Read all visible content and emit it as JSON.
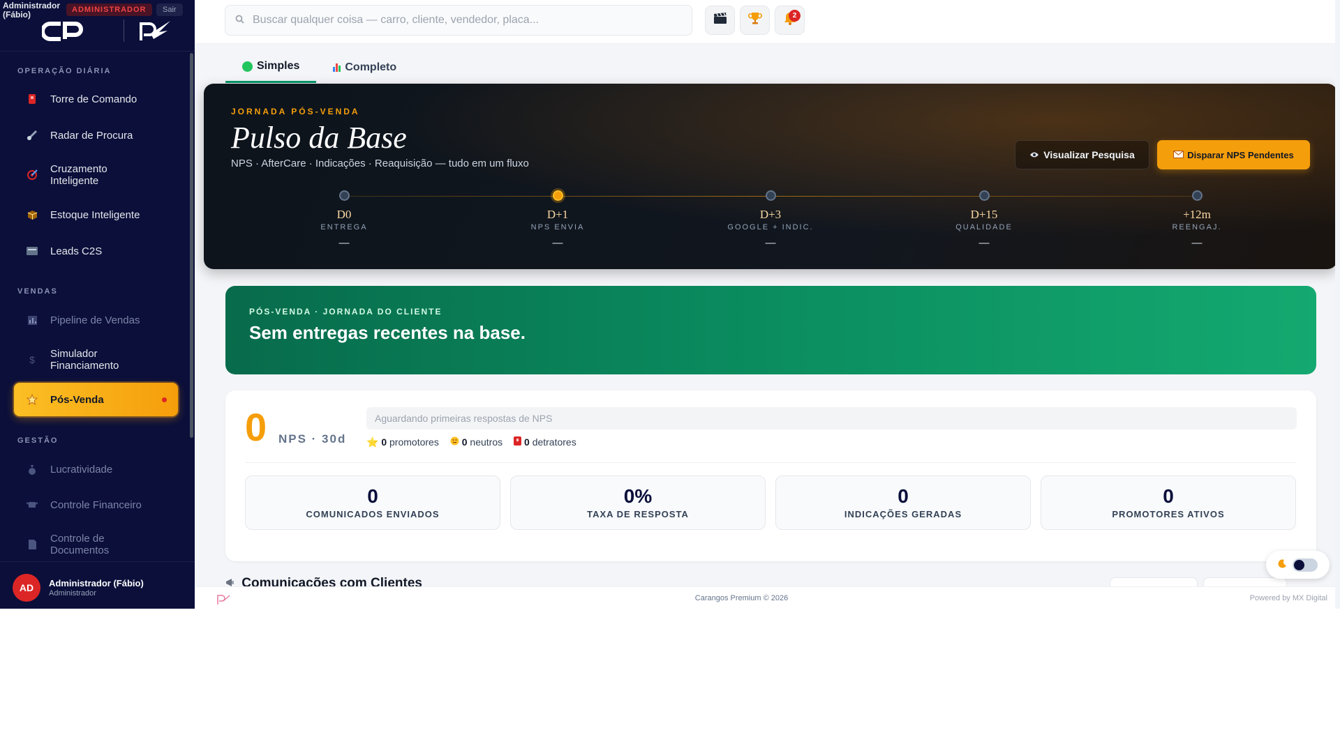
{
  "sidebar": {
    "admin_name": "Administrador (Fábio)",
    "role_badge": "ADMINISTRADOR",
    "logout_label": "Sair",
    "sections": {
      "daily": "OPERAÇÃO DIÁRIA",
      "sales": "VENDAS",
      "management": "GESTÃO"
    },
    "items": [
      {
        "label": "Torre de Comando",
        "icon": "tower-icon"
      },
      {
        "label": "Radar de Procura",
        "icon": "radar-icon"
      },
      {
        "label": "Cruzamento Inteligente",
        "icon": "target-icon"
      },
      {
        "label": "Estoque Inteligente",
        "icon": "box-icon"
      },
      {
        "label": "Leads C2S",
        "icon": "card-icon"
      },
      {
        "label": "Pipeline de Vendas",
        "icon": "bar-chart-icon"
      },
      {
        "label": "Simulador Financiamento",
        "icon": "dollar-icon"
      },
      {
        "label": "Pós-Venda",
        "icon": "star-icon",
        "active": true
      },
      {
        "label": "Lucratividade",
        "icon": "money-bag-icon"
      },
      {
        "label": "Controle Financeiro",
        "icon": "money-wings-icon"
      },
      {
        "label": "Controle de Documentos",
        "icon": "document-icon"
      }
    ],
    "user": {
      "initials": "AD",
      "name": "Administrador (Fábio)",
      "role": "Administrador"
    }
  },
  "topbar": {
    "search_placeholder": "Buscar qualquer coisa — carro, cliente, vendedor, placa...",
    "notification_count": "2"
  },
  "tabs": [
    {
      "label": "Simples",
      "active": true
    },
    {
      "label": "Completo",
      "active": false
    }
  ],
  "hero": {
    "eyebrow": "JORNADA PÓS-VENDA",
    "title": "Pulso da Base",
    "subtitle": "NPS · AfterCare · Indicações · Reaquisição — tudo em um fluxo",
    "view_survey_label": "Visualizar Pesquisa",
    "send_nps_label": "Disparar NPS Pendentes",
    "stages": [
      {
        "day": "D0",
        "label": "ENTREGA",
        "value": "—",
        "active": false
      },
      {
        "day": "D+1",
        "label": "NPS ENVIA",
        "value": "—",
        "active": true
      },
      {
        "day": "D+3",
        "label": "GOOGLE + INDIC.",
        "value": "—",
        "active": false
      },
      {
        "day": "D+15",
        "label": "QUALIDADE",
        "value": "—",
        "active": false
      },
      {
        "day": "+12m",
        "label": "REENGAJ.",
        "value": "—",
        "active": false
      }
    ]
  },
  "banner": {
    "eyebrow": "PÓS-VENDA · JORNADA DO CLIENTE",
    "title": "Sem entregas recentes na base."
  },
  "nps": {
    "score": "0",
    "label": "NPS · 30d",
    "status": "Aguardando primeiras respostas de NPS",
    "promoters_count": "0",
    "promoters_label": "promotores",
    "neutrals_count": "0",
    "neutrals_label": "neutros",
    "detractors_count": "0",
    "detractors_label": "detratores"
  },
  "kpis": [
    {
      "value": "0",
      "caption": "COMUNICADOS ENVIADOS"
    },
    {
      "value": "0%",
      "caption": "TAXA DE RESPOSTA"
    },
    {
      "value": "0",
      "caption": "INDICAÇÕES GERADAS"
    },
    {
      "value": "0",
      "caption": "PROMOTORES ATIVOS"
    }
  ],
  "communications": {
    "title": "Comunicações com Clientes"
  },
  "footer": {
    "copyright": "Carangos Premium © 2026",
    "powered_by": "Powered by MX Digital"
  },
  "colors": {
    "sidebar_bg": "#0b0f3a",
    "accent": "#f59e0b",
    "green": "#0a8a5e",
    "danger": "#dc2626"
  }
}
